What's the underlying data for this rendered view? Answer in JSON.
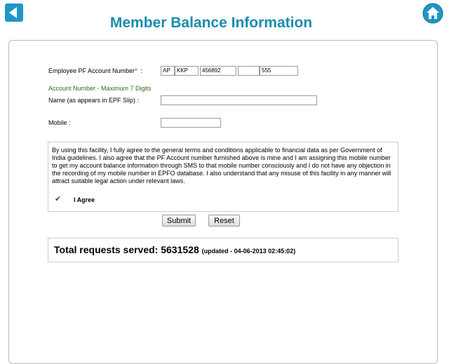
{
  "header": {
    "title": "Member Balance Information",
    "back_icon": "back-arrow-icon",
    "home_icon": "home-icon"
  },
  "form": {
    "pf_label": "Employee PF Account Number",
    "pf_required_mark": "*",
    "pf_colon": ":",
    "pf_fields": [
      "AP",
      "KKP",
      "456892",
      "",
      "555"
    ],
    "hint": "Account Number - Maximum 7 Digits",
    "name_label": "Name (as appears in EPF Slip) :",
    "name_value": "",
    "mobile_label": "Mobile :",
    "mobile_value": ""
  },
  "terms": {
    "text": "By using this facility, I fully agree to the general terms and conditions applicable to financial data as per Government of India guidelines. I also agree that the PF Account number furnished above is mine and I am assigning this mobile number to get my account balance information through SMS to that mobile number consciously and I do not have any objection in the recording of my mobile number in EPFO database. I also understand that any misuse of this facility in any manner will attract suitable legal action under relevant laws.",
    "checkbox_glyph": "✔",
    "agree_label": "I Agree"
  },
  "buttons": {
    "submit": "Submit",
    "reset": "Reset"
  },
  "stats": {
    "label": "Total requests served: 5631528",
    "updated": "(updated - 04-06-2013 02:45:02)"
  },
  "colors": {
    "title": "#1b8cae",
    "nav_button": "#1f97c5",
    "hint": "#2e6b20",
    "required": "#d40000"
  }
}
